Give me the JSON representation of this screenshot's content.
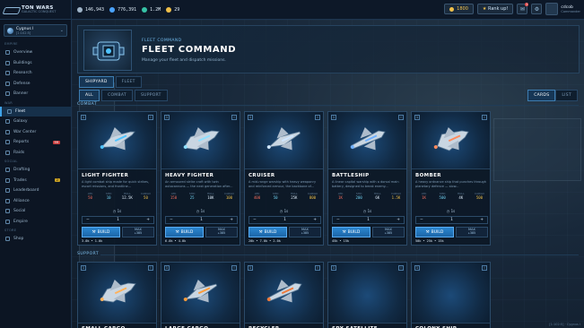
{
  "app": {
    "title": "TON WARS",
    "subtitle": "GALACTIC CONQUEST"
  },
  "resources": [
    {
      "icon": "metal-icon",
      "value": "146,943",
      "color": "#9fb4c8"
    },
    {
      "icon": "crystal-icon",
      "value": "776,391",
      "color": "#4aa3ff"
    },
    {
      "icon": "deuterium-icon",
      "value": "1.2M",
      "color": "#36c2a6"
    },
    {
      "icon": "energy-icon",
      "value": "29",
      "color": "#f0c04a"
    }
  ],
  "topright": {
    "credits": "1800",
    "rank_label": "Rank up!",
    "mail_badge": "1",
    "user_name": "cdcob",
    "user_sub": "Commander"
  },
  "planet": {
    "name": "Cygnus I",
    "coords": "[1:102:5]"
  },
  "sidebar": {
    "sections": [
      {
        "label": "EMPIRE",
        "items": [
          {
            "label": "Overview",
            "icon": "globe-icon"
          },
          {
            "label": "Buildings",
            "icon": "building-icon"
          },
          {
            "label": "Research",
            "icon": "flask-icon"
          },
          {
            "label": "Defense",
            "icon": "shield-icon"
          },
          {
            "label": "Banner",
            "icon": "flag-icon"
          }
        ]
      },
      {
        "label": "WAR",
        "items": [
          {
            "label": "Fleet",
            "icon": "rocket-icon",
            "active": true
          },
          {
            "label": "Galaxy",
            "icon": "galaxy-icon"
          },
          {
            "label": "War Center",
            "icon": "swords-icon"
          },
          {
            "label": "Reports",
            "icon": "report-icon",
            "badge": "99",
            "badge_color": "red"
          },
          {
            "label": "Raids",
            "icon": "target-icon"
          }
        ]
      },
      {
        "label": "SOCIAL",
        "items": [
          {
            "label": "Drafting",
            "icon": "pencil-icon"
          },
          {
            "label": "Trades",
            "icon": "trade-icon",
            "badge": "2",
            "badge_color": "yellow"
          },
          {
            "label": "Leaderboard",
            "icon": "trophy-icon"
          },
          {
            "label": "Alliance",
            "icon": "users-icon"
          },
          {
            "label": "Social",
            "icon": "chat-icon"
          },
          {
            "label": "Empire",
            "icon": "crown-icon"
          }
        ]
      },
      {
        "label": "STORE",
        "items": [
          {
            "label": "Shop",
            "icon": "cart-icon"
          }
        ]
      }
    ]
  },
  "hero": {
    "kicker": "FLEET COMMAND",
    "title": "FLEET COMMAND",
    "desc": "Manage your fleet and dispatch missions."
  },
  "tabs_primary": [
    {
      "label": "SHIPYARD",
      "active": true
    },
    {
      "label": "FLEET"
    }
  ],
  "tabs_filter": [
    {
      "label": "ALL",
      "active": true
    },
    {
      "label": "COMBAT"
    },
    {
      "label": "SUPPORT"
    }
  ],
  "view_toggle": [
    {
      "label": "CARDS",
      "active": true
    },
    {
      "label": "LIST"
    }
  ],
  "sections": {
    "combat": "COMBAT",
    "support": "SUPPORT"
  },
  "stat_labels": [
    "ATK",
    "SHD",
    "HULL",
    "CARGO"
  ],
  "combat_ships": [
    {
      "name": "LIGHT FIGHTER",
      "desc": "A light combat ship made for quick strikes, escort missions, and frontline...",
      "stats": [
        "50",
        "10",
        "12.5K",
        "50"
      ],
      "time": "1s",
      "qty": "1",
      "build": "BUILD",
      "max_label": "MAX",
      "max_value": "+385",
      "cost": "3.0k • 1.0k",
      "accent": "#4fc3ff",
      "lvl": "1"
    },
    {
      "name": "HEAVY FIGHTER",
      "desc": "An armoured strike craft with twin autocannons — the next generation after...",
      "stats": [
        "150",
        "25",
        "10K",
        "100"
      ],
      "time": "1s",
      "qty": "1",
      "build": "BUILD",
      "max_label": "MAX",
      "max_value": "+385",
      "cost": "6.0k • 4.0k",
      "accent": "#8fe0ff",
      "lvl": "1"
    },
    {
      "name": "CRUISER",
      "desc": "A mid-range warship with heavy weaponry and reinforced armour, the backbone of...",
      "stats": [
        "400",
        "50",
        "25K",
        "800"
      ],
      "time": "1s",
      "qty": "1",
      "build": "BUILD",
      "max_label": "MAX",
      "max_value": "+385",
      "cost": "20k • 7.0k • 2.0k",
      "accent": "#cfe6ff",
      "lvl": "1"
    },
    {
      "name": "BATTLESHIP",
      "desc": "A linear capital warship with a dorsal main battery, designed to break enemy...",
      "stats": [
        "1K",
        "200",
        "6K",
        "1.5K"
      ],
      "time": "1s",
      "qty": "1",
      "build": "BUILD",
      "max_label": "MAX",
      "max_value": "+385",
      "cost": "45k • 15k",
      "accent": "#6fb0ff",
      "lvl": "1"
    },
    {
      "name": "BOMBER",
      "desc": "A heavy ordnance ship that punches through planetary defence — slow...",
      "stats": [
        "1K",
        "500",
        "4K",
        "500"
      ],
      "time": "1s",
      "qty": "1",
      "build": "BUILD",
      "max_label": "MAX",
      "max_value": "+385",
      "cost": "50k • 25k • 15k",
      "accent": "#ff8a5c",
      "lvl": "1"
    }
  ],
  "support_ships": [
    {
      "name": "SMALL CARGO",
      "accent": "#ffb25c",
      "lvl": "1"
    },
    {
      "name": "LARGE CARGO",
      "accent": "#ff9c3a",
      "lvl": "1"
    },
    {
      "name": "RECYCLER",
      "accent": "#f07a3a",
      "lvl": "1"
    },
    {
      "name": "SPY SATELLITE",
      "accent": "#6fb0ff",
      "lvl": "1"
    },
    {
      "name": "COLONY SHIP",
      "accent": "#6fb0ff",
      "lvl": "1"
    }
  ],
  "coords_readout": "[1:102:5] · Cygnus I"
}
